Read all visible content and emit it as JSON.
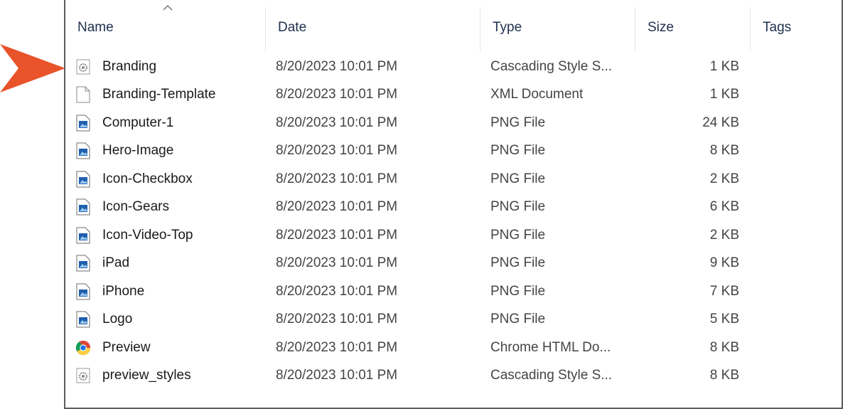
{
  "columns": {
    "name": "Name",
    "date": "Date",
    "type": "Type",
    "size": "Size",
    "tags": "Tags"
  },
  "colors": {
    "pointer_arrow": "#e8532a",
    "header_text": "#1e2f4d",
    "border": "#5c5c5c"
  },
  "files": [
    {
      "name": "Branding",
      "date": "8/20/2023 10:01 PM",
      "type": "Cascading Style S...",
      "size": "1 KB",
      "icon": "css-gear-icon"
    },
    {
      "name": "Branding-Template",
      "date": "8/20/2023 10:01 PM",
      "type": "XML Document",
      "size": "1 KB",
      "icon": "blank-document-icon"
    },
    {
      "name": "Computer-1",
      "date": "8/20/2023 10:01 PM",
      "type": "PNG File",
      "size": "24 KB",
      "icon": "image-file-icon"
    },
    {
      "name": "Hero-Image",
      "date": "8/20/2023 10:01 PM",
      "type": "PNG File",
      "size": "8 KB",
      "icon": "image-file-icon"
    },
    {
      "name": "Icon-Checkbox",
      "date": "8/20/2023 10:01 PM",
      "type": "PNG File",
      "size": "2 KB",
      "icon": "image-file-icon"
    },
    {
      "name": "Icon-Gears",
      "date": "8/20/2023 10:01 PM",
      "type": "PNG File",
      "size": "6 KB",
      "icon": "image-file-icon"
    },
    {
      "name": "Icon-Video-Top",
      "date": "8/20/2023 10:01 PM",
      "type": "PNG File",
      "size": "2 KB",
      "icon": "image-file-icon"
    },
    {
      "name": "iPad",
      "date": "8/20/2023 10:01 PM",
      "type": "PNG File",
      "size": "9 KB",
      "icon": "image-file-icon"
    },
    {
      "name": "iPhone",
      "date": "8/20/2023 10:01 PM",
      "type": "PNG File",
      "size": "7 KB",
      "icon": "image-file-icon"
    },
    {
      "name": "Logo",
      "date": "8/20/2023 10:01 PM",
      "type": "PNG File",
      "size": "5 KB",
      "icon": "image-file-icon"
    },
    {
      "name": "Preview",
      "date": "8/20/2023 10:01 PM",
      "type": "Chrome HTML Do...",
      "size": "8 KB",
      "icon": "chrome-icon"
    },
    {
      "name": "preview_styles",
      "date": "8/20/2023 10:01 PM",
      "type": "Cascading Style S...",
      "size": "8 KB",
      "icon": "css-gear-icon"
    }
  ]
}
